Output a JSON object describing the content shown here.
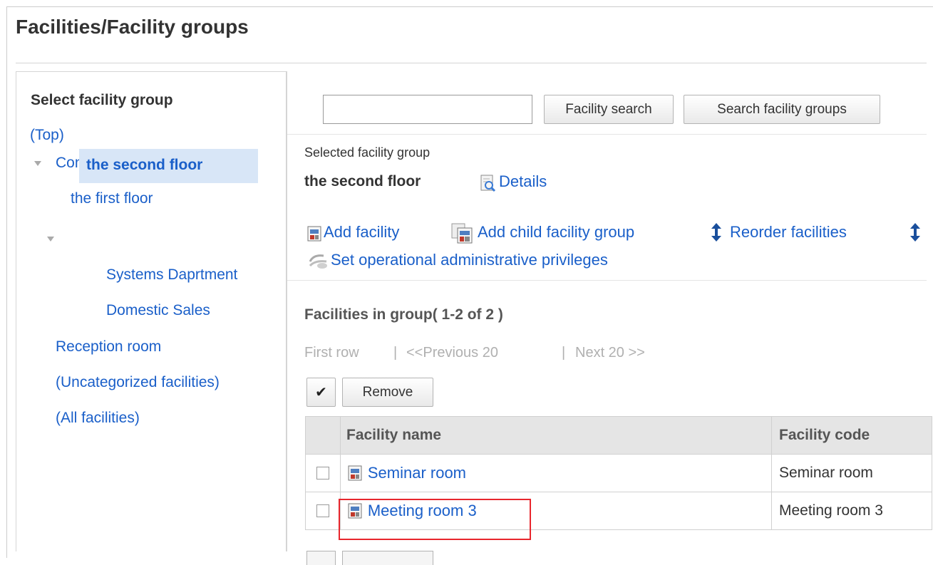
{
  "page": {
    "title": "Facilities/Facility groups"
  },
  "sidebar": {
    "heading": "Select facility group",
    "top_link": "(Top)",
    "items": [
      {
        "label": "Conference room"
      },
      {
        "label": "the first floor"
      },
      {
        "label": "the second floor"
      },
      {
        "label": "Systems Daprtment"
      },
      {
        "label": "Domestic Sales"
      },
      {
        "label": "Reception room"
      },
      {
        "label": "(Uncategorized facilities)"
      },
      {
        "label": "(All facilities)"
      }
    ]
  },
  "search": {
    "value": "",
    "placeholder": "",
    "facility_search_label": "Facility search",
    "group_search_label": "Search facility groups"
  },
  "selected_group": {
    "label": "Selected facility group",
    "value": "the second floor",
    "details_label": "Details"
  },
  "actions": {
    "add_facility": "Add facility",
    "add_child_group": "Add child facility group",
    "reorder_facilities": "Reorder facilities",
    "set_privileges": "Set operational administrative privileges"
  },
  "facilities": {
    "heading": "Facilities in group( 1-2 of 2 )",
    "pagination": {
      "first": "First row",
      "separator": "|",
      "previous": "<<Previous 20",
      "next": "Next 20 >>"
    },
    "check_all_glyph": "✔",
    "remove_label": "Remove",
    "columns": [
      "Facility name",
      "Facility code"
    ],
    "rows": [
      {
        "name": "Seminar room",
        "code": "Seminar room"
      },
      {
        "name": "Meeting room 3",
        "code": "Meeting room 3"
      }
    ]
  },
  "colors": {
    "link": "#1a5fc9",
    "selected_bg": "#d8e6f7",
    "highlight": "#e8262d",
    "header_bg": "#e5e5e5"
  }
}
